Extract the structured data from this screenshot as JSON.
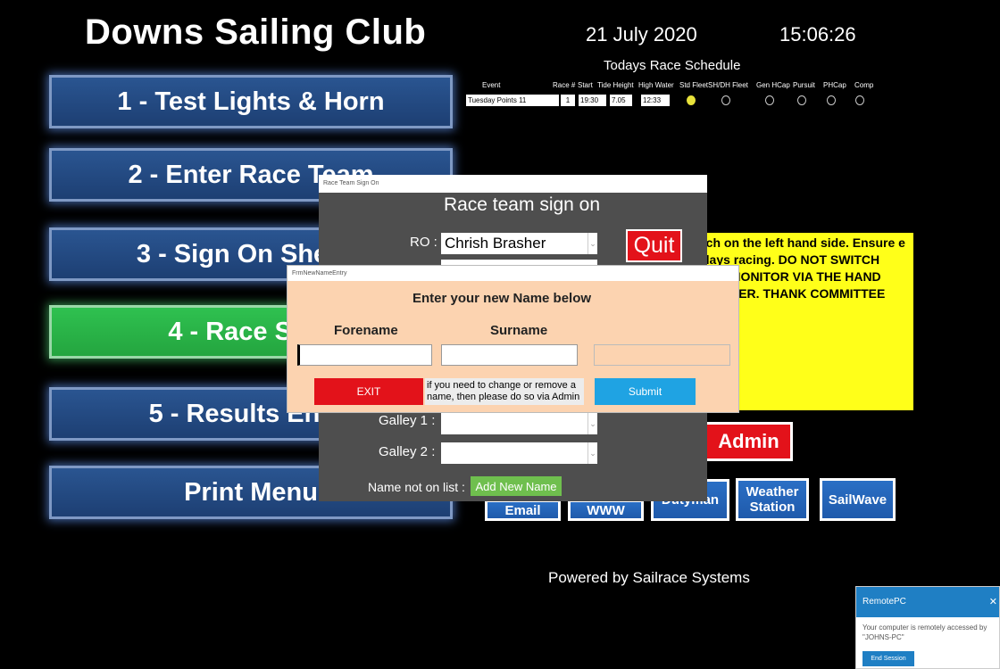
{
  "app": {
    "title": "Downs Sailing Club"
  },
  "menu": {
    "items": [
      {
        "label": "1 - Test Lights & Horn"
      },
      {
        "label": "2 - Enter Race Team"
      },
      {
        "label": "3 - Sign On Sheets"
      },
      {
        "label": "4 - Race Start"
      },
      {
        "label": "5 - Results Entry"
      },
      {
        "label": "Print Menu"
      }
    ]
  },
  "header": {
    "date": "21 July 2020",
    "time": "15:06:26"
  },
  "schedule": {
    "title": "Todays Race Schedule",
    "columns": [
      "Event",
      "Race #",
      "Start",
      "Tide Height",
      "High Water",
      "Std Fleet",
      "SH/DH Fleet",
      "Gen HCap",
      "Pursuit",
      "PHCap",
      "Comp"
    ],
    "row": {
      "event": "Tuesday Points 11",
      "race_no": "1",
      "start": "19:30",
      "tide_height": "7.05",
      "high_water": "12:33",
      "selected_fleet": "Std Fleet"
    }
  },
  "notice": {
    "text": "tch on the left hand side. Ensure e days racing. DO NOT SWITCH THE MONITOR VIA THE HAND CORNER.   THANK COMMITTEE"
  },
  "buttons": {
    "admin": "Admin",
    "email": "Email",
    "www": "WWW",
    "dutyman": "Dutyman",
    "weather": "Weather Station",
    "sailwave": "SailWave"
  },
  "footer": {
    "powered": "Powered by Sailrace Systems"
  },
  "race_team_window": {
    "title": "Race Team Sign On",
    "heading": "Race team sign on",
    "ro_label": "RO :",
    "ro_value": "Chrish Brasher",
    "quit": "Quit",
    "galley1_label": "Galley  1 :",
    "galley2_label": "Galley  2 :",
    "not_on_list_label": "Name not on list :",
    "add_new_name": "Add New Name"
  },
  "new_name_window": {
    "title": "FrmNewNameEntry",
    "heading": "Enter your new Name below",
    "forename_label": "Forename",
    "surname_label": "Surname",
    "exit": "EXIT",
    "note": "if you need to change or remove a name, then please do so via Admin",
    "submit": "Submit"
  },
  "remotepc": {
    "title": "RemotePC",
    "message": "Your computer is remotely accessed by \"JOHNS-PC\"",
    "end_session": "End Session"
  },
  "colors": {
    "menu_blue": "#2a5591",
    "menu_green": "#2fc150",
    "notice_yellow": "#ffff19",
    "admin_red": "#e3121a",
    "new_name_bg": "#fcd3b0",
    "submit_blue": "#1fa3e3"
  }
}
